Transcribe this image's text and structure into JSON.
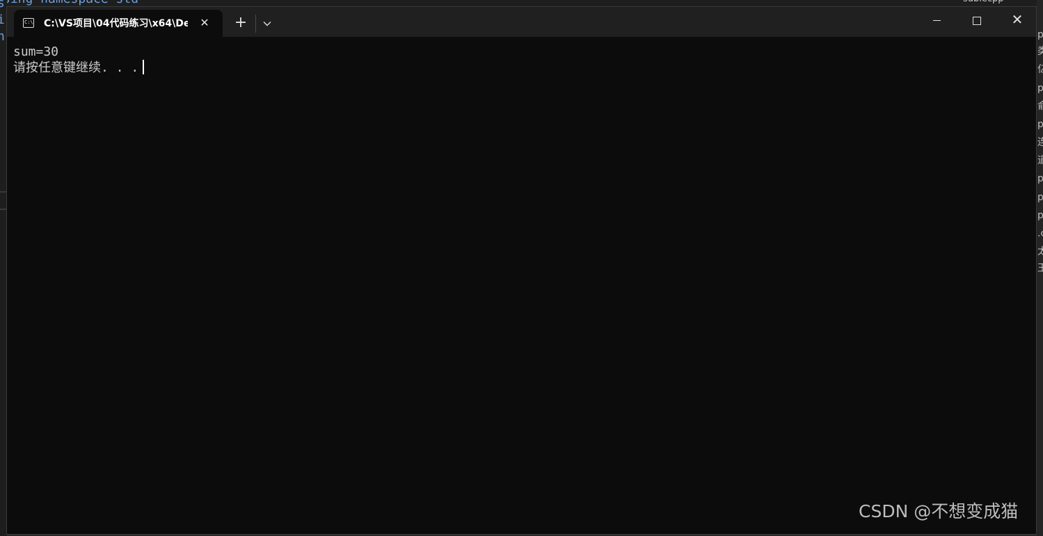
{
  "window": {
    "tab": {
      "title": "C:\\VS项目\\04代码练习\\x64\\De",
      "icon": "console-icon",
      "icon_text": "C:\\",
      "close_label": "✕"
    },
    "new_tab_label": "+",
    "dropdown_label": "⌄",
    "controls": {
      "close_label": "✕"
    }
  },
  "console": {
    "lines": [
      "sum=30",
      "请按任意键继续. . ."
    ]
  },
  "background": {
    "left_fragments": [
      "s",
      "i",
      "n"
    ],
    "top_fragment": "sing namespace std",
    "top_right_fragment": "sublecpp",
    "right_glyphs": [
      "p",
      "类",
      "亿",
      "p",
      "俞",
      "p",
      "连",
      "道",
      "p",
      "p",
      "p",
      ".c",
      "太",
      "王"
    ]
  },
  "watermark": "CSDN @不想变成猫"
}
